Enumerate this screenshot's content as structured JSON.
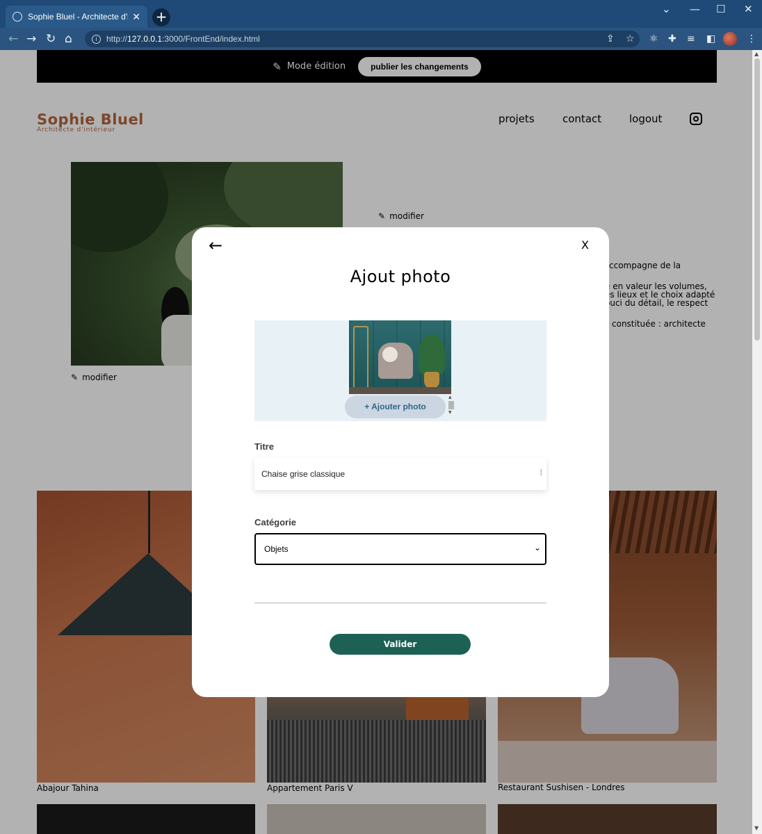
{
  "browser": {
    "tab_title": "Sophie Bluel - Architecte d'intérieur",
    "tab_close": "✕",
    "new_tab": "+",
    "url_host": "127.0.0.1",
    "url_prefix": "http://",
    "url_path": ":3000/FrontEnd/index.html"
  },
  "edit_banner": {
    "mode_label": "Mode édition",
    "publish_label": "publier les changements"
  },
  "header": {
    "logo_name": "Sophie Bluel",
    "logo_subtitle": "Architecte d'intérieur",
    "nav": [
      "projets",
      "contact",
      "logout"
    ]
  },
  "intro": {
    "modify_photo": "modifier",
    "modify_text": "modifier",
    "visible_text_lines": [
      "ccompagne de la",
      "e en valeur les volumes,",
      "es lieux et le choix adapté",
      "ouci du détail, le respect",
      "constituée : architecte"
    ]
  },
  "gallery": {
    "captions": [
      "Abajour Tahina",
      "Appartement Paris V",
      "Restaurant Sushisen - Londres"
    ]
  },
  "modal": {
    "back_icon": "←",
    "close_label": "X",
    "title": "Ajout photo",
    "add_photo_label": "+ Ajouter photo",
    "title_field_label": "Titre",
    "title_field_value": "Chaise grise classique",
    "category_field_label": "Catégorie",
    "category_value": "Objets",
    "submit_label": "Valider"
  },
  "colors": {
    "accent": "#1d6154",
    "logo": "#b1663c",
    "upload_bg": "#e8f1f6",
    "add_photo_bg": "#cbd6e2",
    "add_photo_text": "#306685"
  }
}
